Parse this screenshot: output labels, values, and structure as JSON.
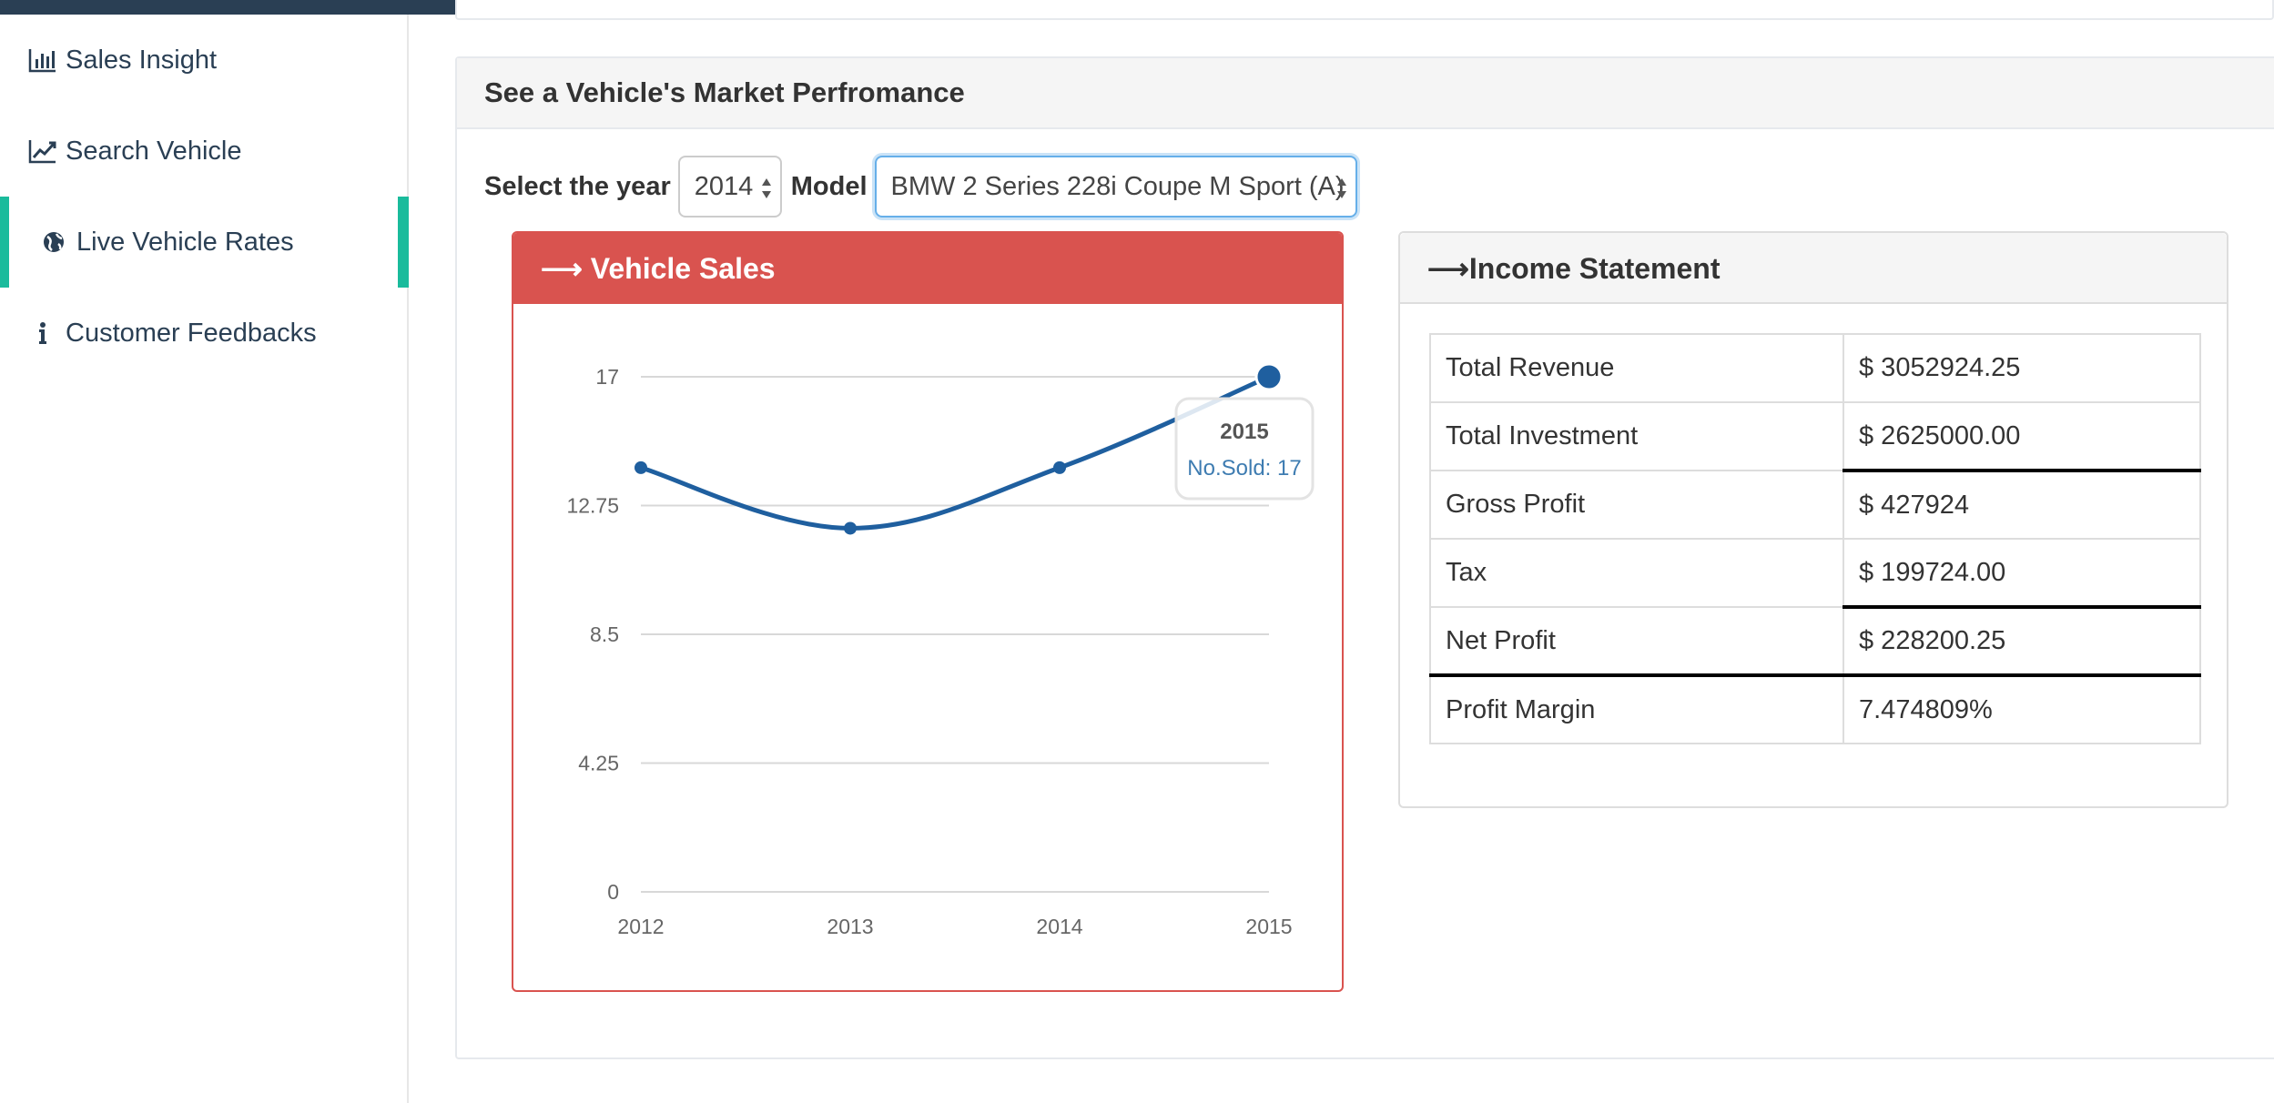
{
  "sidebar": {
    "items": [
      {
        "label": "Sales Insight",
        "icon": "bar-chart-icon"
      },
      {
        "label": "Search Vehicle",
        "icon": "line-chart-icon"
      },
      {
        "label": "Live Vehicle Rates",
        "icon": "globe-icon",
        "active": true
      },
      {
        "label": "Customer Feedbacks",
        "icon": "info-icon"
      }
    ]
  },
  "panel": {
    "title": "See a Vehicle's Market Perfromance",
    "year_label": "Select the year",
    "year_value": "2014",
    "model_label": "Model",
    "model_value": "BMW 2 Series 228i Coupe M Sport (A)"
  },
  "sales": {
    "title": "Vehicle Sales",
    "tooltip": {
      "year": "2015",
      "text": "No.Sold: 17"
    }
  },
  "chart_data": {
    "type": "line",
    "title": "Vehicle Sales",
    "categories": [
      "2012",
      "2013",
      "2014",
      "2015"
    ],
    "series": [
      {
        "name": "No.Sold",
        "values": [
          14,
          12,
          14,
          17
        ]
      }
    ],
    "yticks": [
      "0",
      "4.25",
      "8.5",
      "12.75",
      "17"
    ],
    "ylim": [
      0,
      17
    ],
    "grid": true,
    "color": "#1f5f9f"
  },
  "income": {
    "title": "Income Statement",
    "rows": [
      {
        "label": "Total Revenue",
        "value": "$ 3052924.25"
      },
      {
        "label": "Total Investment",
        "value": "$ 2625000.00"
      },
      {
        "label": "Gross Profit",
        "value": "$ 427924"
      },
      {
        "label": "Tax",
        "value": "$ 199724.00"
      },
      {
        "label": "Net Profit",
        "value": "$ 228200.25"
      },
      {
        "label": "Profit Margin",
        "value": "7.474809%"
      }
    ]
  },
  "colors": {
    "accent": "#1abb9c",
    "danger": "#d9534f",
    "nav_text": "#2a3f54",
    "line": "#1f5f9f"
  }
}
